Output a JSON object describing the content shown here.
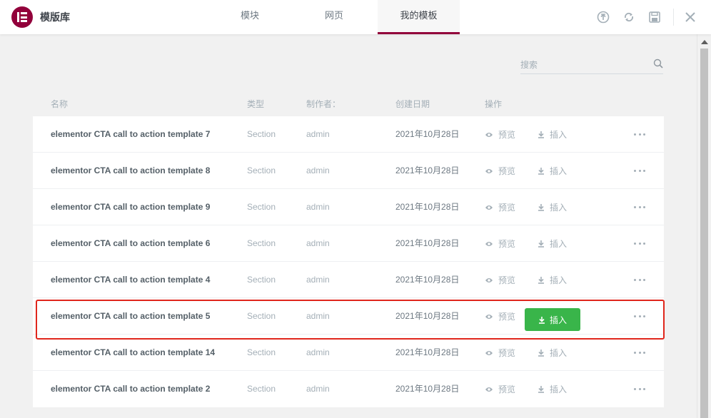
{
  "header": {
    "title": "模版库",
    "tabs": [
      {
        "label": "模块"
      },
      {
        "label": "网页"
      },
      {
        "label": "我的模板"
      }
    ],
    "active_tab": "我的模板",
    "icons": [
      "upload-icon",
      "sync-icon",
      "save-icon",
      "close-icon"
    ],
    "brand_color": "#92003b"
  },
  "search": {
    "placeholder": "搜索"
  },
  "columns": {
    "name": "名称",
    "type": "类型",
    "author": "制作者：",
    "date": "创建日期",
    "actions": "操作"
  },
  "actions": {
    "preview": "预览",
    "insert": "插入"
  },
  "rows": [
    {
      "name": "elementor CTA call to action template 7",
      "type": "Section",
      "author": "admin",
      "date": "2021年10月28日"
    },
    {
      "name": "elementor CTA call to action template 8",
      "type": "Section",
      "author": "admin",
      "date": "2021年10月28日"
    },
    {
      "name": "elementor CTA call to action template 9",
      "type": "Section",
      "author": "admin",
      "date": "2021年10月28日"
    },
    {
      "name": "elementor CTA call to action template 6",
      "type": "Section",
      "author": "admin",
      "date": "2021年10月28日"
    },
    {
      "name": "elementor CTA call to action template 4",
      "type": "Section",
      "author": "admin",
      "date": "2021年10月28日"
    },
    {
      "name": "elementor CTA call to action template 5",
      "type": "Section",
      "author": "admin",
      "date": "2021年10月28日",
      "hovered": true
    },
    {
      "name": "elementor CTA call to action template 14",
      "type": "Section",
      "author": "admin",
      "date": "2021年10月28日"
    },
    {
      "name": "elementor CTA call to action template 2",
      "type": "Section",
      "author": "admin",
      "date": "2021年10月28日"
    }
  ],
  "colors": {
    "insert_button": "#39b54a",
    "highlight_border": "#e0261c"
  }
}
